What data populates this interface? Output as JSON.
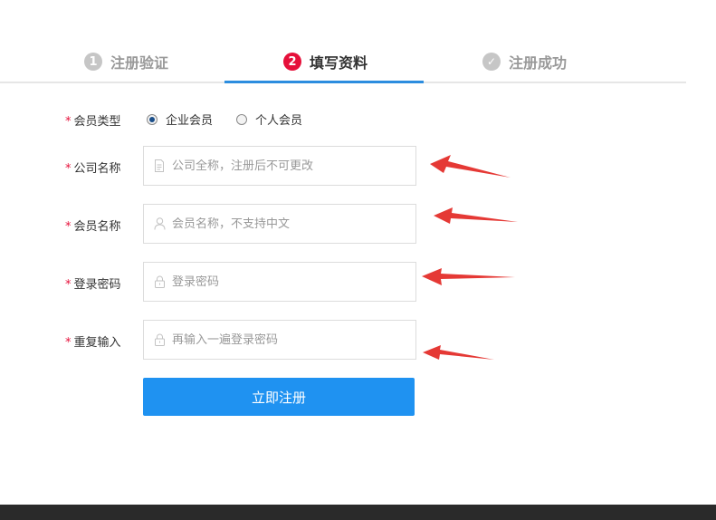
{
  "steps": [
    {
      "number": "1",
      "label": "注册验证",
      "state": "done"
    },
    {
      "number": "2",
      "label": "填写资料",
      "state": "active"
    },
    {
      "number": "✓",
      "label": "注册成功",
      "state": "pending"
    }
  ],
  "colors": {
    "accent": "#2c8ddf",
    "active_step": "#e6103a",
    "button": "#1f92f1",
    "required": "#e6103a",
    "arrow": "#e53935",
    "footer": "#2a2a2a"
  },
  "form": {
    "required_mark": "*",
    "member_type": {
      "label": "会员类型",
      "options": [
        {
          "label": "企业会员",
          "selected": true
        },
        {
          "label": "个人会员",
          "selected": false
        }
      ]
    },
    "company_name": {
      "label": "公司名称",
      "placeholder": "公司全称，注册后不可更改",
      "icon": "document-icon"
    },
    "member_name": {
      "label": "会员名称",
      "placeholder": "会员名称，不支持中文",
      "icon": "user-icon"
    },
    "password": {
      "label": "登录密码",
      "placeholder": "登录密码",
      "icon": "lock-icon"
    },
    "password_confirm": {
      "label": "重复输入",
      "placeholder": "再输入一遍登录密码",
      "icon": "lock-icon"
    },
    "submit_label": "立即注册"
  }
}
